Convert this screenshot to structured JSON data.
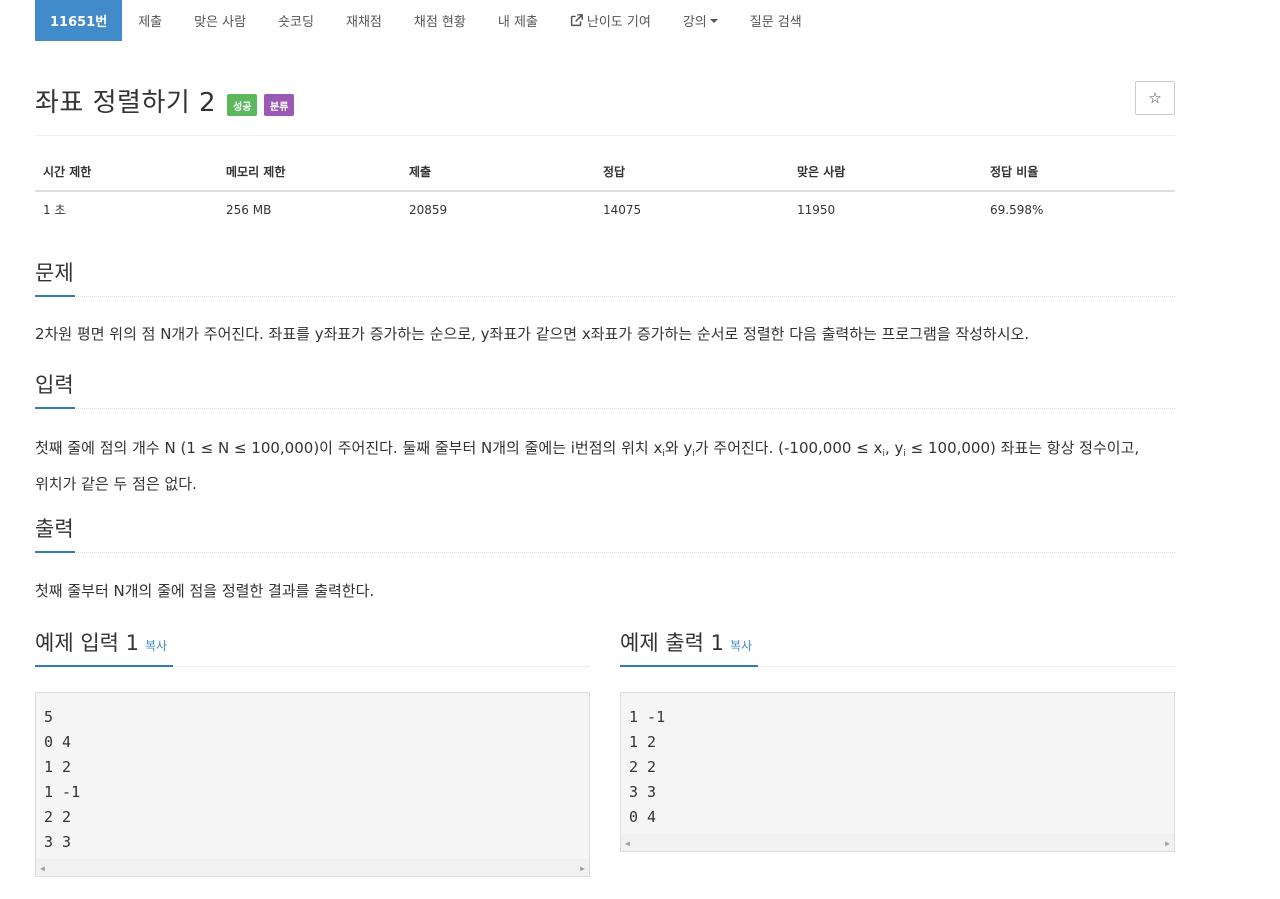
{
  "nav": {
    "items": [
      {
        "label": "11651번"
      },
      {
        "label": "제출"
      },
      {
        "label": "맞은 사람"
      },
      {
        "label": "숏코딩"
      },
      {
        "label": "재채점"
      },
      {
        "label": "채점 현황"
      },
      {
        "label": "내 제출"
      },
      {
        "label": "난이도 기여"
      },
      {
        "label": "강의"
      },
      {
        "label": "질문 검색"
      }
    ]
  },
  "problem": {
    "title": "좌표 정렬하기 2",
    "label_success": "성공",
    "label_tags": "분류",
    "star_icon": "☆"
  },
  "stats": {
    "headers": [
      "시간 제한",
      "메모리 제한",
      "제출",
      "정답",
      "맞은 사람",
      "정답 비율"
    ],
    "values": [
      "1 초",
      "256 MB",
      "20859",
      "14075",
      "11950",
      "69.598%"
    ]
  },
  "sections": {
    "problem_heading": "문제",
    "problem_text": "2차원 평면 위의 점 N개가 주어진다. 좌표를 y좌표가 증가하는 순으로, y좌표가 같으면 x좌표가 증가하는 순서로 정렬한 다음 출력하는 프로그램을 작성하시오.",
    "input_heading": "입력",
    "input_text_1": "첫째 줄에 점의 개수 N (1 ≤ N ≤ 100,000)이 주어진다. 둘째 줄부터 N개의 줄에는 i번점의 위치 x",
    "input_sub_1": "i",
    "input_text_2": "와 y",
    "input_sub_2": "i",
    "input_text_3": "가 주어진다. (-100,000 ≤ x",
    "input_sub_3": "i",
    "input_text_4": ", y",
    "input_sub_4": "i",
    "input_text_5": " ≤ 100,000) 좌표는 항상 정수이고,",
    "input_text_6": "위치가 같은 두 점은 없다.",
    "output_heading": "출력",
    "output_text": "첫째 줄부터 N개의 줄에 점을 정렬한 결과를 출력한다."
  },
  "samples": {
    "input_heading": "예제 입력 1",
    "output_heading": "예제 출력 1",
    "copy_label": "복사",
    "input_lines": [
      "5",
      "0 4",
      "1 2",
      "1 -1",
      "2 2",
      "3 3"
    ],
    "output_lines": [
      "1 -1",
      "1 2",
      "2 2",
      "3 3",
      "0 4"
    ]
  }
}
